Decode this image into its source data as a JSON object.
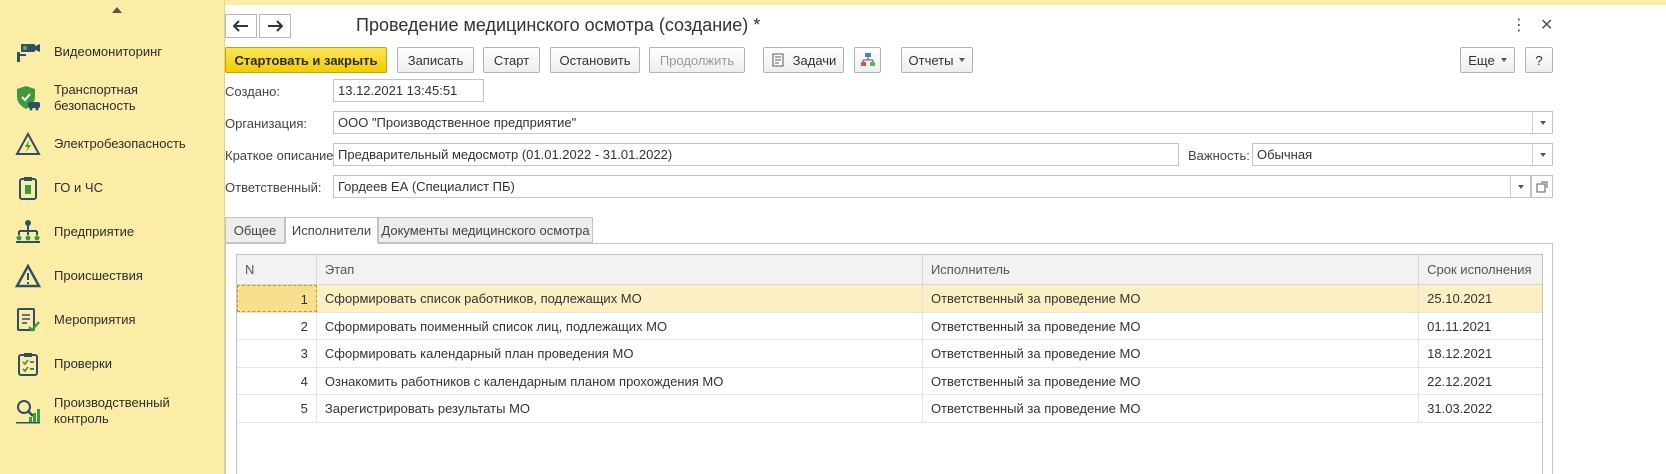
{
  "sidebar": {
    "items": [
      {
        "label": "Видеомониторинг",
        "icon": "video-monitoring-icon"
      },
      {
        "label": "Транспортная\nбезопасность",
        "icon": "shield-car-icon"
      },
      {
        "label": "Электробезопасность",
        "icon": "electric-warning-icon"
      },
      {
        "label": "ГО и ЧС",
        "icon": "civil-defense-icon"
      },
      {
        "label": "Предприятие",
        "icon": "org-structure-icon"
      },
      {
        "label": "Происшествия",
        "icon": "warning-triangle-icon"
      },
      {
        "label": "Мероприятия",
        "icon": "checklist-icon"
      },
      {
        "label": "Проверки",
        "icon": "clipboard-check-icon"
      },
      {
        "label": "Производственный\nконтроль",
        "icon": "production-control-icon"
      }
    ]
  },
  "window": {
    "title": "Проведение медицинского осмотра (создание) *"
  },
  "toolbar": {
    "start_close": "Стартовать и закрыть",
    "save": "Записать",
    "start": "Старт",
    "stop": "Остановить",
    "continue": "Продолжить",
    "tasks": "Задачи",
    "reports": "Отчеты",
    "more": "Еще",
    "help": "?"
  },
  "form": {
    "created_label": "Создано:",
    "created_value": "13.12.2021 13:45:51",
    "org_label": "Организация:",
    "org_value": "ООО \"Производственное предприятие\"",
    "desc_label": "Краткое описание:",
    "desc_value": "Предварительный медосмотр (01.01.2022 - 31.01.2022)",
    "importance_label": "Важность:",
    "importance_value": "Обычная",
    "responsible_label": "Ответственный:",
    "responsible_value": "Гордеев ЕА (Специалист ПБ)"
  },
  "tabs": [
    {
      "label": "Общее"
    },
    {
      "label": "Исполнители"
    },
    {
      "label": "Документы медицинского осмотра"
    }
  ],
  "table": {
    "columns": [
      "N",
      "Этап",
      "Исполнитель",
      "Срок исполнения"
    ],
    "rows": [
      {
        "n": "1",
        "stage": "Сформировать список работников, подлежащих МО",
        "executor": "Ответственный за проведение МО",
        "due": "25.10.2021"
      },
      {
        "n": "2",
        "stage": "Сформировать поименный список лиц, подлежащих МО",
        "executor": "Ответственный за проведение МО",
        "due": "01.11.2021"
      },
      {
        "n": "3",
        "stage": "Сформировать календарный план проведения МО",
        "executor": "Ответственный за проведение МО",
        "due": "18.12.2021"
      },
      {
        "n": "4",
        "stage": "Ознакомить работников с календарным планом прохождения МО",
        "executor": "Ответственный за проведение МО",
        "due": "22.12.2021"
      },
      {
        "n": "5",
        "stage": "Зарегистрировать результаты МО",
        "executor": "Ответственный за проведение МО",
        "due": "31.03.2022"
      }
    ]
  }
}
